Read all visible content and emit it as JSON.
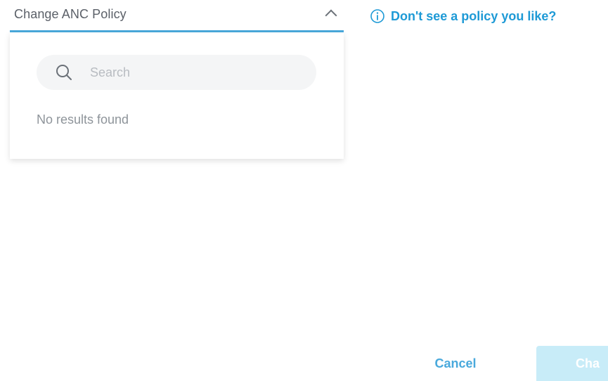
{
  "policy_select": {
    "label": "Change ANC Policy",
    "expanded": true
  },
  "dropdown": {
    "search_placeholder": "Search",
    "empty_message": "No results found"
  },
  "help_link": {
    "text": "Don't see a policy you like?"
  },
  "footer": {
    "cancel_label": "Cancel",
    "change_label": "Cha"
  },
  "colors": {
    "accent": "#1e9ad6",
    "underline": "#49a9dc",
    "disabled_button": "#c8ecf8"
  }
}
